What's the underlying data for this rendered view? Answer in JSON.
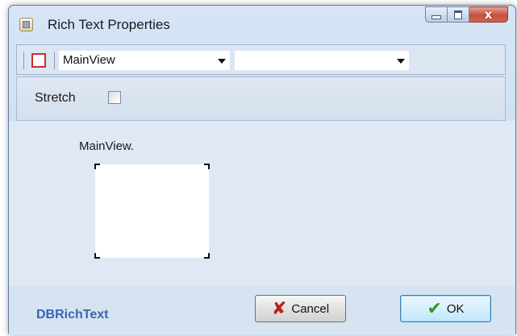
{
  "window": {
    "title": "Rich Text Properties",
    "icons": {
      "app": "form-properties-icon",
      "minimize": "minimize-icon",
      "maximize": "maximize-icon",
      "close": "close-icon"
    },
    "close_glyph": "x"
  },
  "toolbar": {
    "border_color_icon": "border-color-icon",
    "border_color": "#d12c2c",
    "view_combo": {
      "value": "MainView"
    },
    "secondary_combo": {
      "value": ""
    }
  },
  "options": {
    "stretch_label": "Stretch",
    "stretch_checked": false
  },
  "preview": {
    "view_name": "MainView."
  },
  "footer": {
    "brand": "DBRichText",
    "cancel_label": "Cancel",
    "ok_label": "OK",
    "cancel_icon": "cancel-x-icon",
    "ok_icon": "ok-checkmark-icon",
    "brand_color": "#3966b3"
  }
}
